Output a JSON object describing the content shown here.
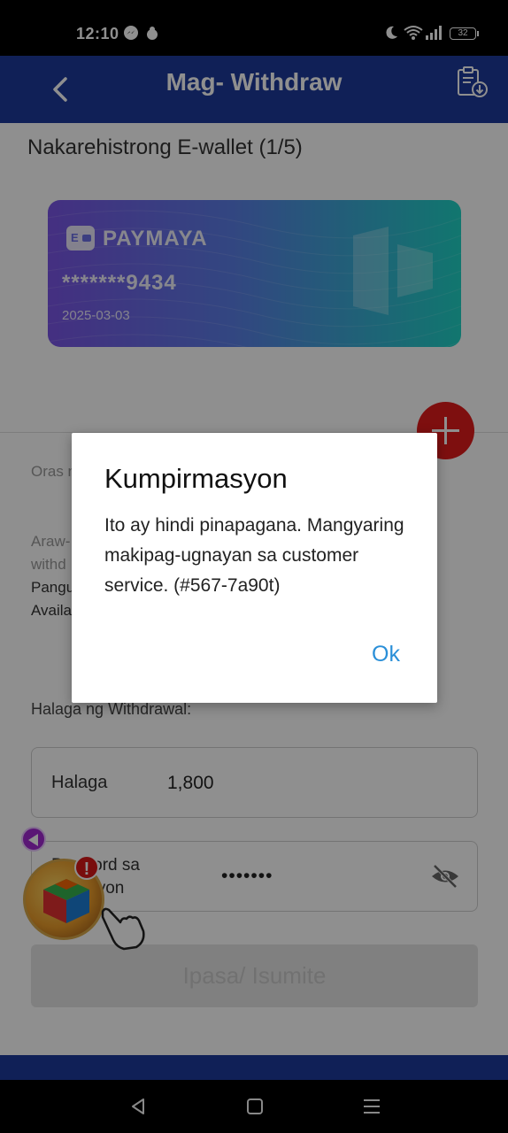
{
  "status_bar": {
    "time": "12:10",
    "battery": "32",
    "icons": [
      "messenger-icon",
      "notification-app-icon",
      "moon-icon",
      "wifi-icon",
      "signal-icon",
      "battery-icon"
    ]
  },
  "header": {
    "title": "Mag- Withdraw",
    "back_icon": "chevron-left-icon",
    "history_icon": "clipboard-download-icon",
    "background": "#1e3a9c"
  },
  "wallet": {
    "heading": "Nakarehistrong E-wallet (1/5)",
    "card": {
      "brand": "PAYMAYA",
      "account": "*******9434",
      "date": "2025-03-03"
    },
    "add_button_color": "#e01b1b"
  },
  "info": {
    "oras_label": "Oras n",
    "araw_line1": "Araw-",
    "araw_line2": "withd",
    "pangu": "Pangu",
    "avail": "Availa"
  },
  "form": {
    "amount_section_label": "Halaga ng Withdrawal:",
    "amount_label": "Halaga",
    "amount_value": "1,800",
    "password_label_line1": "P    word sa",
    "password_label_line2": "      akyon",
    "password_value": "•••••••",
    "submit_label": "Ipasa/ Isumite"
  },
  "floating": {
    "badge": "!"
  },
  "dialog": {
    "title": "Kumpirmasyon",
    "message": "Ito ay hindi pinapagana. Mangyaring makipag-ugnayan sa customer service. (#567-7a90t)",
    "ok_label": "Ok",
    "ok_color": "#2a8fd8"
  },
  "navbar": {
    "icons": [
      "back-triangle-icon",
      "home-square-icon",
      "recents-menu-icon"
    ]
  }
}
